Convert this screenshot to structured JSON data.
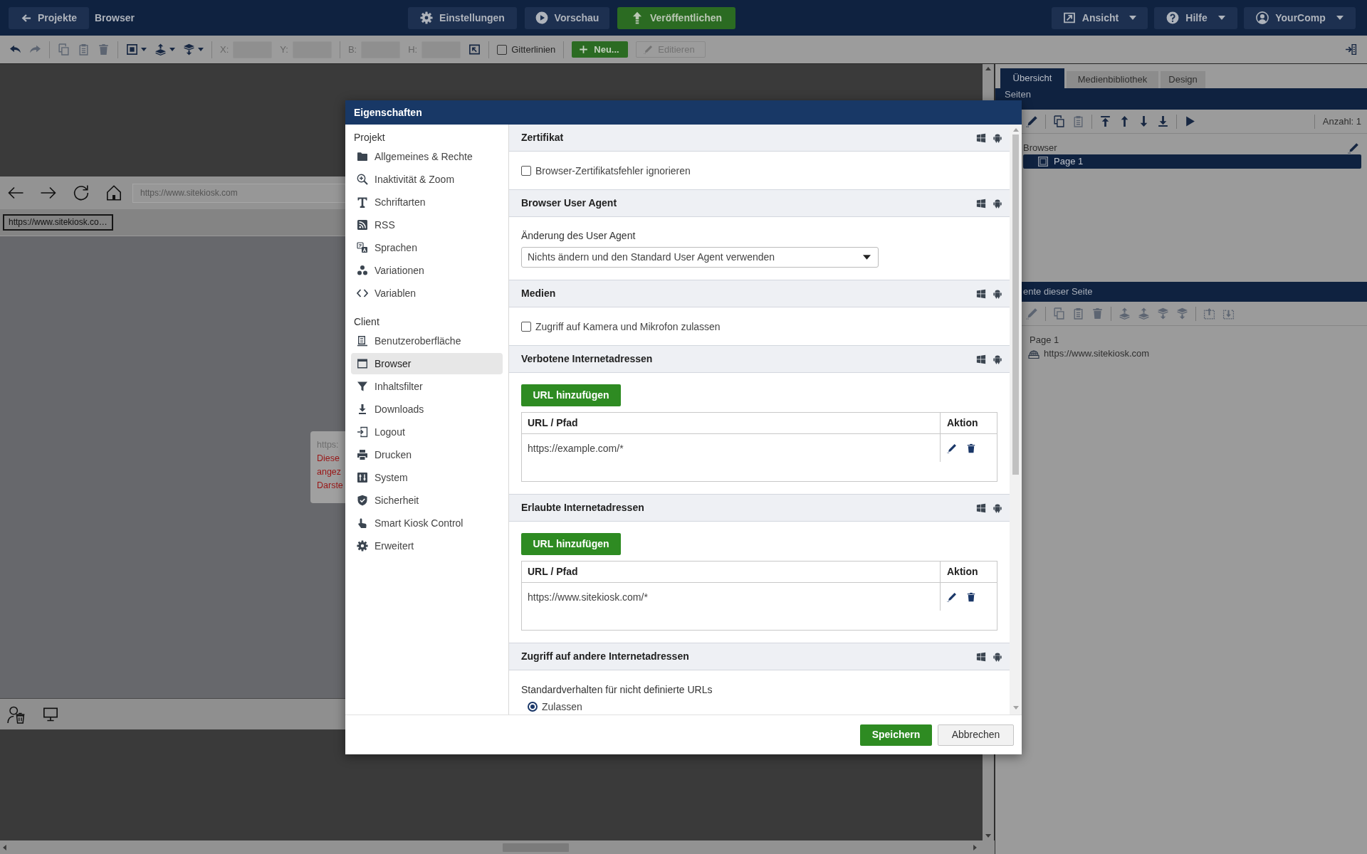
{
  "top_bar": {
    "back_button": "Projekte",
    "project_name": "Browser",
    "center_buttons": [
      {
        "kind": "settings",
        "label": "Einstellungen"
      },
      {
        "kind": "preview",
        "label": "Vorschau"
      },
      {
        "kind": "publish",
        "label": "Veröffentlichen"
      }
    ],
    "menus": [
      {
        "kind": "view",
        "label": "Ansicht"
      },
      {
        "kind": "help",
        "label": "Hilfe"
      },
      {
        "kind": "account",
        "label": "YourComp"
      }
    ]
  },
  "toolbar": {
    "groups": [
      {
        "items": [
          {
            "kind": "undo",
            "disabled": false
          },
          {
            "kind": "redo",
            "disabled": true
          }
        ]
      },
      {
        "items": [
          {
            "kind": "copy",
            "disabled": true
          },
          {
            "kind": "paste",
            "disabled": true
          },
          {
            "kind": "delete",
            "disabled": true
          }
        ]
      },
      {
        "items": [
          {
            "kind": "frame",
            "disabled": false
          },
          {
            "kind": "raise",
            "disabled": false
          },
          {
            "kind": "lower",
            "disabled": false
          }
        ]
      },
      {
        "items": [
          {
            "kind": "field",
            "label": "X:"
          },
          {
            "kind": "field",
            "label": "Y:"
          }
        ]
      },
      {
        "items": [
          {
            "kind": "field",
            "label": "B:"
          },
          {
            "kind": "field",
            "label": "H:"
          },
          {
            "kind": "fit",
            "disabled": false
          }
        ]
      },
      {
        "items": [
          {
            "kind": "checkbox",
            "label": "Gitterlinien",
            "checked": false
          }
        ]
      },
      {
        "items": [
          {
            "kind": "newbutton",
            "label": "Neu..."
          },
          {
            "kind": "editbutton",
            "label": "Editieren",
            "disabled": true
          }
        ]
      }
    ]
  },
  "canvas": {
    "browser_preview": {
      "address": "https://www.sitekiosk.com",
      "tab": "https://www.sitekiosk.co…"
    },
    "tooltip": [
      {
        "kind": "url",
        "text": "https:"
      },
      {
        "kind": "error",
        "text": "Diese"
      },
      {
        "kind": "error",
        "text": "angez"
      },
      {
        "kind": "error",
        "text": "Darste"
      }
    ]
  },
  "right_panel": {
    "tabs": [
      {
        "label": "Übersicht",
        "selected": true
      },
      {
        "label": "Medienbibliothek",
        "selected": false
      },
      {
        "label": "Design",
        "selected": false
      }
    ],
    "pages": {
      "title": "Seiten",
      "tools": [
        {
          "items": [
            {
              "kind": "edit",
              "disabled": false
            }
          ]
        },
        {
          "items": [
            {
              "kind": "copy",
              "disabled": false
            },
            {
              "kind": "paste",
              "disabled": true
            }
          ]
        },
        {
          "items": [
            {
              "kind": "first",
              "disabled": false
            },
            {
              "kind": "up",
              "disabled": false
            },
            {
              "kind": "down",
              "disabled": false
            },
            {
              "kind": "last",
              "disabled": false
            }
          ]
        },
        {
          "items": [
            {
              "kind": "play",
              "disabled": false
            }
          ]
        }
      ],
      "count": "Anzahl: 1",
      "tree": [
        {
          "label": "Browser",
          "selected": false,
          "children": [
            {
              "label": "Page 1",
              "selected": true
            }
          ]
        }
      ]
    },
    "elements": {
      "title": "ente dieser Seite",
      "tools": [
        {
          "items": [
            {
              "kind": "edit",
              "disabled": true
            }
          ]
        },
        {
          "items": [
            {
              "kind": "copy",
              "disabled": true
            },
            {
              "kind": "paste",
              "disabled": true
            },
            {
              "kind": "delete",
              "disabled": true
            }
          ]
        },
        {
          "items": [
            {
              "kind": "raise",
              "disabled": true
            },
            {
              "kind": "forward",
              "disabled": true
            },
            {
              "kind": "backward",
              "disabled": true
            },
            {
              "kind": "lower",
              "disabled": true
            }
          ]
        },
        {
          "items": [
            {
              "kind": "import",
              "disabled": true
            },
            {
              "kind": "export",
              "disabled": true
            }
          ]
        }
      ],
      "tree": [
        {
          "label": "Page 1",
          "children": [
            {
              "label": "https://www.sitekiosk.com"
            }
          ]
        }
      ]
    }
  },
  "dialog": {
    "title": "Eigenschaften",
    "nav_groups": [
      {
        "heading": "Projekt",
        "items": [
          {
            "label": "Allgemeines & Rechte",
            "selected": false
          },
          {
            "label": "Inaktivität & Zoom",
            "selected": false
          },
          {
            "label": "Schriftarten",
            "selected": false
          },
          {
            "label": "RSS",
            "selected": false
          },
          {
            "label": "Sprachen",
            "selected": false
          },
          {
            "label": "Variationen",
            "selected": false
          },
          {
            "label": "Variablen",
            "selected": false
          }
        ]
      },
      {
        "heading": "Client",
        "items": [
          {
            "label": "Benutzeroberfläche",
            "selected": false
          },
          {
            "label": "Browser",
            "selected": true
          },
          {
            "label": "Inhaltsfilter",
            "selected": false
          },
          {
            "label": "Downloads",
            "selected": false
          },
          {
            "label": "Logout",
            "selected": false
          },
          {
            "label": "Drucken",
            "selected": false
          },
          {
            "label": "System",
            "selected": false
          },
          {
            "label": "Sicherheit",
            "selected": false
          },
          {
            "label": "Smart Kiosk Control",
            "selected": false
          },
          {
            "label": "Erweitert",
            "selected": false
          }
        ]
      }
    ],
    "sections": [
      {
        "title": "Zertifikat",
        "body": {
          "kind": "checkbox",
          "label": "Browser-Zertifikatsfehler ignorieren",
          "checked": false
        }
      },
      {
        "title": "Browser User Agent",
        "body": {
          "kind": "select",
          "label": "Änderung des User Agent",
          "value": "Nichts ändern und den Standard User Agent verwenden"
        }
      },
      {
        "title": "Medien",
        "body": {
          "kind": "checkbox",
          "label": "Zugriff auf Kamera und Mikrofon zulassen",
          "checked": false
        }
      },
      {
        "title": "Verbotene Internetadressen",
        "body": {
          "kind": "urltable",
          "button": "URL hinzufügen",
          "columns": [
            "URL / Pfad",
            "Aktion"
          ],
          "rows": [
            {
              "url": "https://example.com/*"
            }
          ]
        }
      },
      {
        "title": "Erlaubte Internetadressen",
        "body": {
          "kind": "urltable",
          "button": "URL hinzufügen",
          "columns": [
            "URL / Pfad",
            "Aktion"
          ],
          "rows": [
            {
              "url": "https://www.sitekiosk.com/*"
            }
          ]
        }
      },
      {
        "title": "Zugriff auf andere Internetadressen",
        "body": {
          "kind": "radiogroup",
          "label": "Standardverhalten für nicht definierte URLs",
          "options": [
            {
              "label": "Zulassen",
              "selected": true
            }
          ]
        }
      }
    ],
    "buttons": [
      {
        "kind": "primary",
        "label": "Speichern"
      },
      {
        "kind": "secondary",
        "label": "Abbrechen"
      }
    ]
  }
}
